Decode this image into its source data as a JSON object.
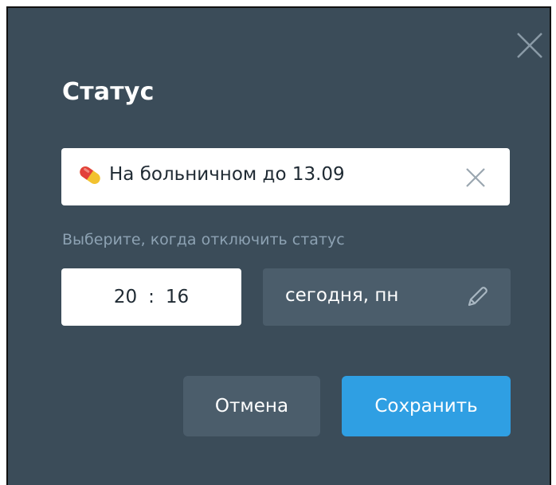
{
  "dialog": {
    "title": "Статус",
    "close_icon": "close-icon"
  },
  "status": {
    "emoji_icon": "pill-icon",
    "text": "На больничном до 13.09",
    "clear_icon": "close-icon"
  },
  "expiry": {
    "hint": "Выберите, когда отключить статус",
    "hours": "20",
    "separator": ":",
    "minutes": "16",
    "date": "сегодня, пн",
    "edit_icon": "pencil-icon"
  },
  "actions": {
    "cancel_label": "Отмена",
    "save_label": "Сохранить"
  },
  "colors": {
    "dialog_background": "#3b4c59",
    "secondary_button": "#4b5d6b",
    "primary_button": "#2f9fe3",
    "hint_text": "#8da2b3"
  }
}
